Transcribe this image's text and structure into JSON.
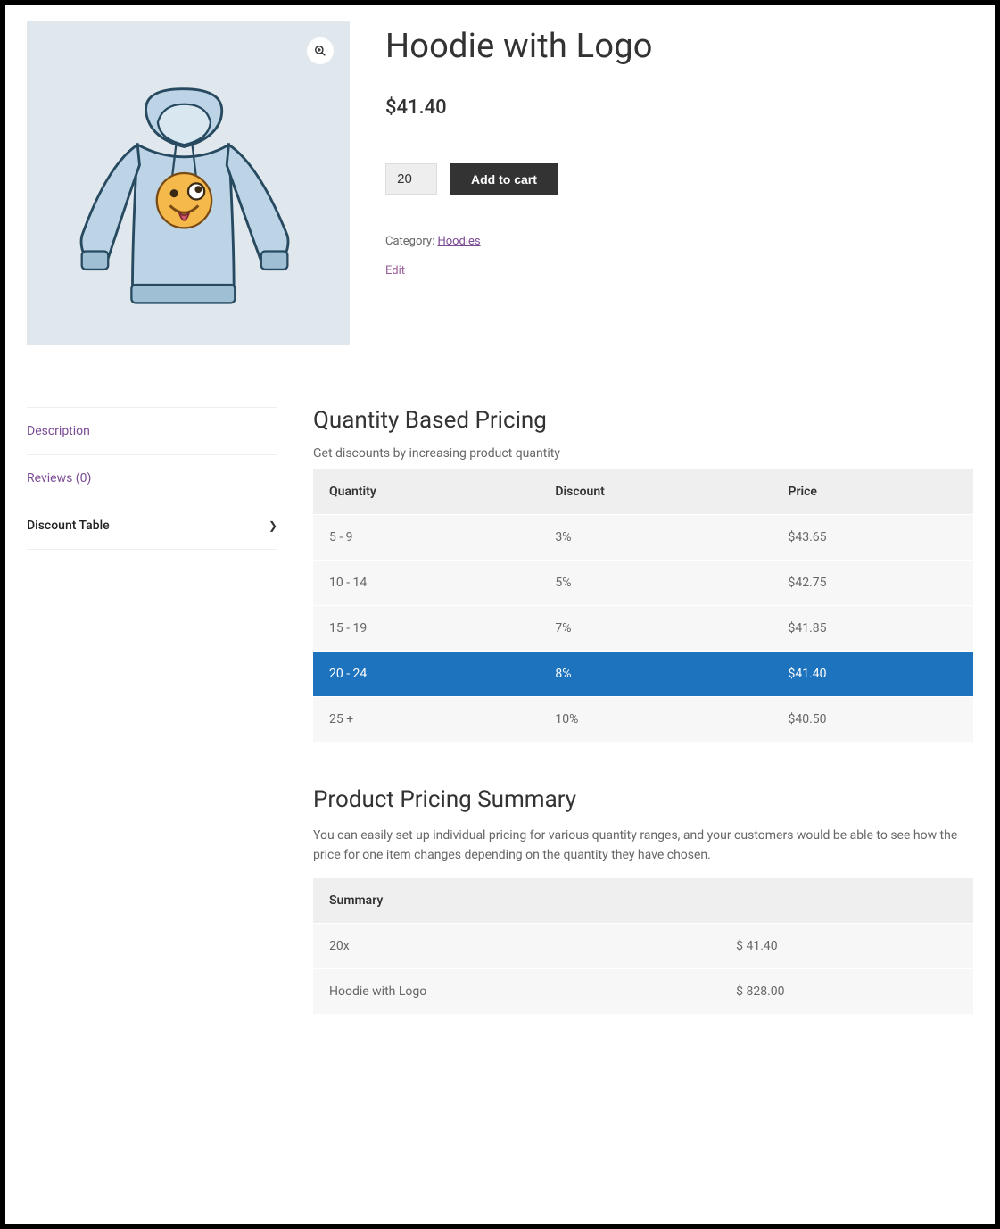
{
  "product": {
    "title": "Hoodie with Logo",
    "price": "$41.40",
    "quantity": "20",
    "add_to_cart": "Add to cart",
    "category_label": "Category: ",
    "category_link": "Hoodies",
    "edit": "Edit"
  },
  "tabs": {
    "description": "Description",
    "reviews": "Reviews (0)",
    "discount_table": "Discount Table"
  },
  "qbp": {
    "heading": "Quantity Based Pricing",
    "subtitle": "Get discounts by increasing product quantity",
    "col_quantity": "Quantity",
    "col_discount": "Discount",
    "col_price": "Price",
    "rows": [
      {
        "quantity": "5 - 9",
        "discount": "3%",
        "price": "$43.65"
      },
      {
        "quantity": "10 - 14",
        "discount": "5%",
        "price": "$42.75"
      },
      {
        "quantity": "15 - 19",
        "discount": "7%",
        "price": "$41.85"
      },
      {
        "quantity": "20 - 24",
        "discount": "8%",
        "price": "$41.40"
      },
      {
        "quantity": "25 +",
        "discount": "10%",
        "price": "$40.50"
      }
    ],
    "highlight_index": 3
  },
  "pps": {
    "heading": "Product Pricing Summary",
    "description": "You can easily set up individual pricing for various quantity ranges, and your customers would be able to see how the price for one item changes depending on the quantity they have chosen.",
    "col_summary": "Summary",
    "row1_qty": "20x",
    "row1_price": "$ 41.40",
    "row2_name": "Hoodie with Logo",
    "row2_total": "$ 828.00"
  }
}
